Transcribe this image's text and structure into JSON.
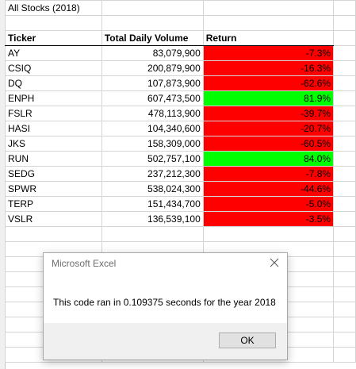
{
  "sheet": {
    "title": "All Stocks (2018)",
    "headers": {
      "ticker": "Ticker",
      "volume": "Total Daily Volume",
      "return": "Return"
    },
    "rows": [
      {
        "ticker": "AY",
        "volume": "83,079,900",
        "return": "-7.3%",
        "positive": false
      },
      {
        "ticker": "CSIQ",
        "volume": "200,879,900",
        "return": "-16.3%",
        "positive": false
      },
      {
        "ticker": "DQ",
        "volume": "107,873,900",
        "return": "-62.6%",
        "positive": false
      },
      {
        "ticker": "ENPH",
        "volume": "607,473,500",
        "return": "81.9%",
        "positive": true
      },
      {
        "ticker": "FSLR",
        "volume": "478,113,900",
        "return": "-39.7%",
        "positive": false
      },
      {
        "ticker": "HASI",
        "volume": "104,340,600",
        "return": "-20.7%",
        "positive": false
      },
      {
        "ticker": "JKS",
        "volume": "158,309,000",
        "return": "-60.5%",
        "positive": false
      },
      {
        "ticker": "RUN",
        "volume": "502,757,100",
        "return": "84.0%",
        "positive": true
      },
      {
        "ticker": "SEDG",
        "volume": "237,212,300",
        "return": "-7.8%",
        "positive": false
      },
      {
        "ticker": "SPWR",
        "volume": "538,024,300",
        "return": "-44.6%",
        "positive": false
      },
      {
        "ticker": "TERP",
        "volume": "151,434,700",
        "return": "-5.0%",
        "positive": false
      },
      {
        "ticker": "VSLR",
        "volume": "136,539,100",
        "return": "-3.5%",
        "positive": false
      }
    ]
  },
  "colors": {
    "positive": "#00ff00",
    "negative": "#ff0000"
  },
  "dialog": {
    "title": "Microsoft Excel",
    "message": "This code ran in 0.109375 seconds for the year 2018",
    "ok_label": "OK",
    "close_icon": "close-icon"
  }
}
